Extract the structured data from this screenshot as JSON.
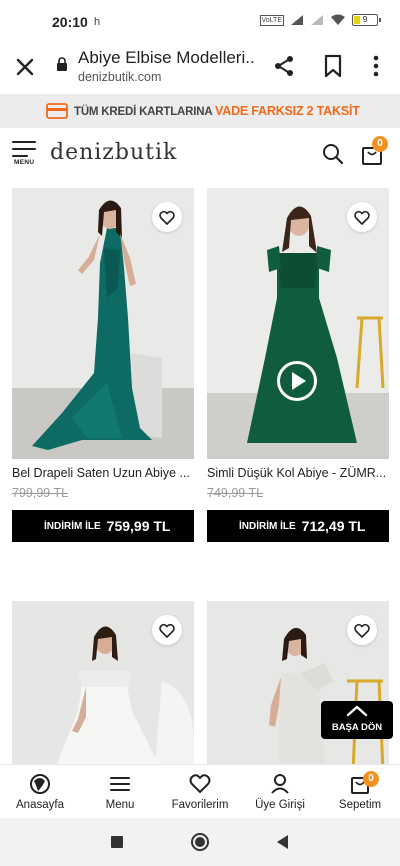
{
  "status_bar": {
    "time": "20:10",
    "extra": "h",
    "volte": "VoLTE",
    "battery": "9"
  },
  "browser": {
    "page_title": "Abiye Elbise Modelleri...",
    "domain": "denizbutik.com"
  },
  "promo": {
    "text_main": "TÜM KREDİ KARTLARINA ",
    "text_accent": "VADE FARKSIZ 2 TAKSİT",
    "accent_color": "#f06a1c"
  },
  "header": {
    "menu_label": "MENU",
    "logo": "denizbutik",
    "cart_count": "0"
  },
  "products": [
    {
      "name": "Bel Drapeli Saten Uzun Abiye ...",
      "old_price": "799,99 TL",
      "price_label": "İNDİRİM İLE",
      "price": "759,99 TL"
    },
    {
      "name": "Simli Düşük Kol Abiye - ZÜMR...",
      "old_price": "749,99 TL",
      "price_label": "İNDİRİM İLE",
      "price": "712,49 TL"
    },
    {
      "name": "",
      "old_price": "",
      "price_label": "",
      "price": ""
    },
    {
      "name": "",
      "old_price": "",
      "price_label": "",
      "price": ""
    }
  ],
  "back_to_top": "BAŞA DÖN",
  "bottom_nav": {
    "items": [
      {
        "label": "Anasayfa",
        "icon": "home-icon"
      },
      {
        "label": "Menu",
        "icon": "menu-icon"
      },
      {
        "label": "Favorilerim",
        "icon": "heart-icon"
      },
      {
        "label": "Üye Girişi",
        "icon": "user-icon"
      },
      {
        "label": "Sepetim",
        "icon": "cart-icon"
      }
    ],
    "cart_count": "0"
  }
}
